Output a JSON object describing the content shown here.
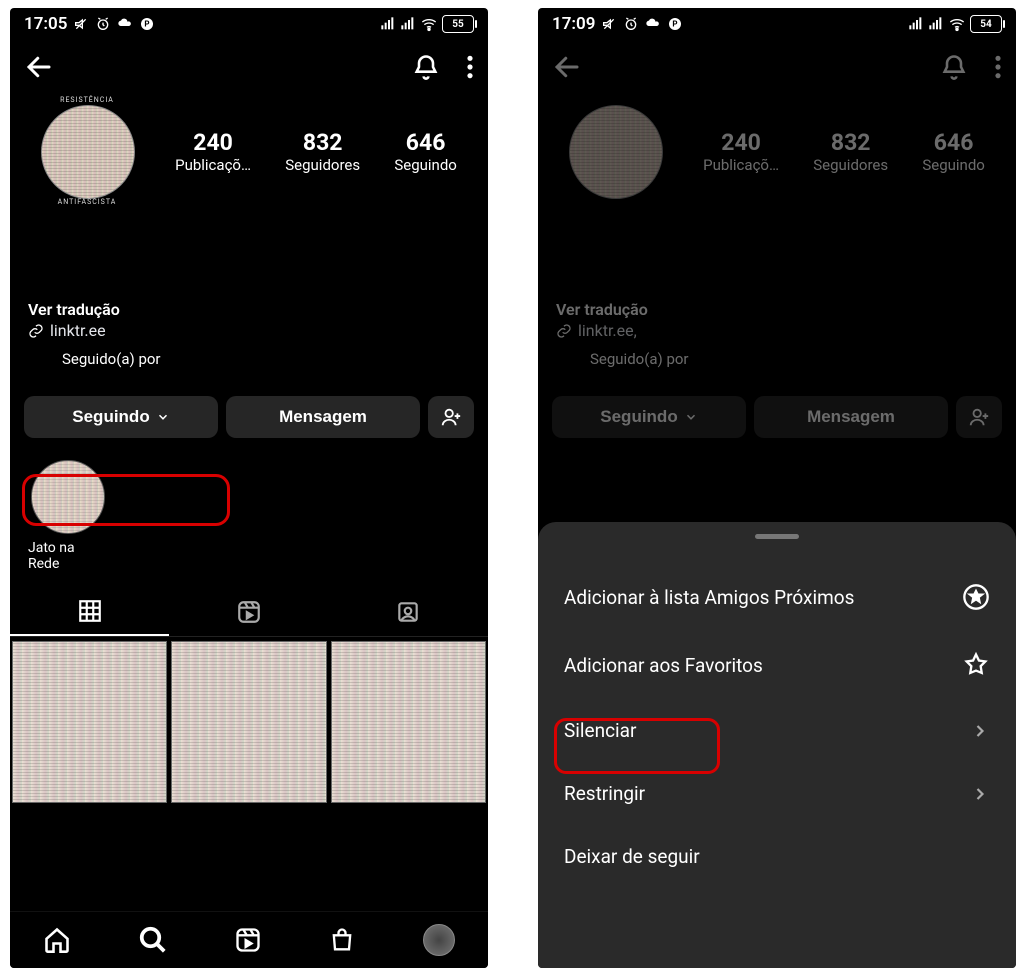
{
  "left": {
    "status": {
      "time": "17:05",
      "battery": "55"
    },
    "stats": {
      "posts": {
        "num": "240",
        "label": "Publicaçõ…"
      },
      "followers": {
        "num": "832",
        "label": "Seguidores"
      },
      "following": {
        "num": "646",
        "label": "Seguindo"
      }
    },
    "avatar": {
      "arc_top": "RESISTÊNCIA",
      "arc_bot": "ANTIFASCISTA"
    },
    "bio": {
      "translate": "Ver tradução",
      "link": "linktr.ee"
    },
    "followed_by": "Seguido(a) por",
    "buttons": {
      "following": "Seguindo",
      "message": "Mensagem"
    },
    "highlight": {
      "label": "Jato na Rede"
    }
  },
  "right": {
    "status": {
      "time": "17:09",
      "battery": "54"
    },
    "stats": {
      "posts": {
        "num": "240",
        "label": "Publicaçõ…"
      },
      "followers": {
        "num": "832",
        "label": "Seguidores"
      },
      "following": {
        "num": "646",
        "label": "Seguindo"
      }
    },
    "bio": {
      "translate": "Ver tradução",
      "link": "linktr.ee,"
    },
    "followed_by": "Seguido(a) por",
    "buttons": {
      "following": "Seguindo",
      "message": "Mensagem"
    },
    "sheet": {
      "close_friends": "Adicionar à lista Amigos Próximos",
      "favorites": "Adicionar aos Favoritos",
      "mute": "Silenciar",
      "restrict": "Restringir",
      "unfollow": "Deixar de seguir"
    }
  }
}
